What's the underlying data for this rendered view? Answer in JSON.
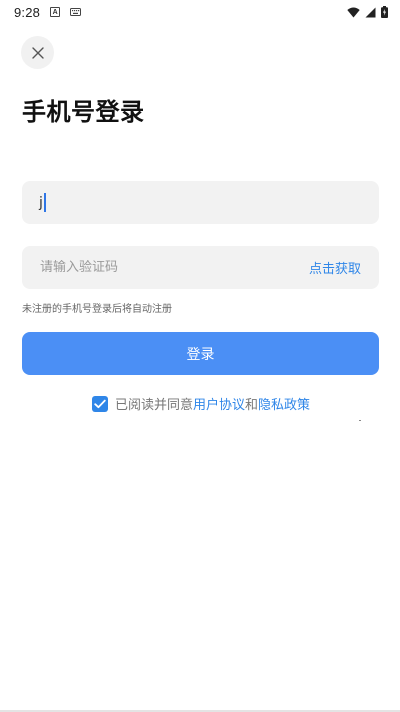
{
  "status_bar": {
    "time": "9:28",
    "notification_icons": [
      "a-box-icon",
      "keyboard-icon"
    ],
    "system_icons": [
      "wifi-icon",
      "signal-icon",
      "battery-icon"
    ]
  },
  "header": {
    "close_icon": "close-icon",
    "title": "手机号登录"
  },
  "form": {
    "phone_value": "j",
    "code_placeholder": "请输入验证码",
    "get_code_label": "点击获取",
    "hint": "未注册的手机号登录后将自动注册",
    "login_label": "登录"
  },
  "agreement": {
    "checked": true,
    "prefix": "已阅读并同意",
    "user_agreement": "用户协议",
    "and": "和",
    "privacy_policy": "隐私政策"
  },
  "colors": {
    "accent": "#2f86e8",
    "primary_button": "#4b8ff5",
    "field_bg": "#f2f2f2"
  }
}
